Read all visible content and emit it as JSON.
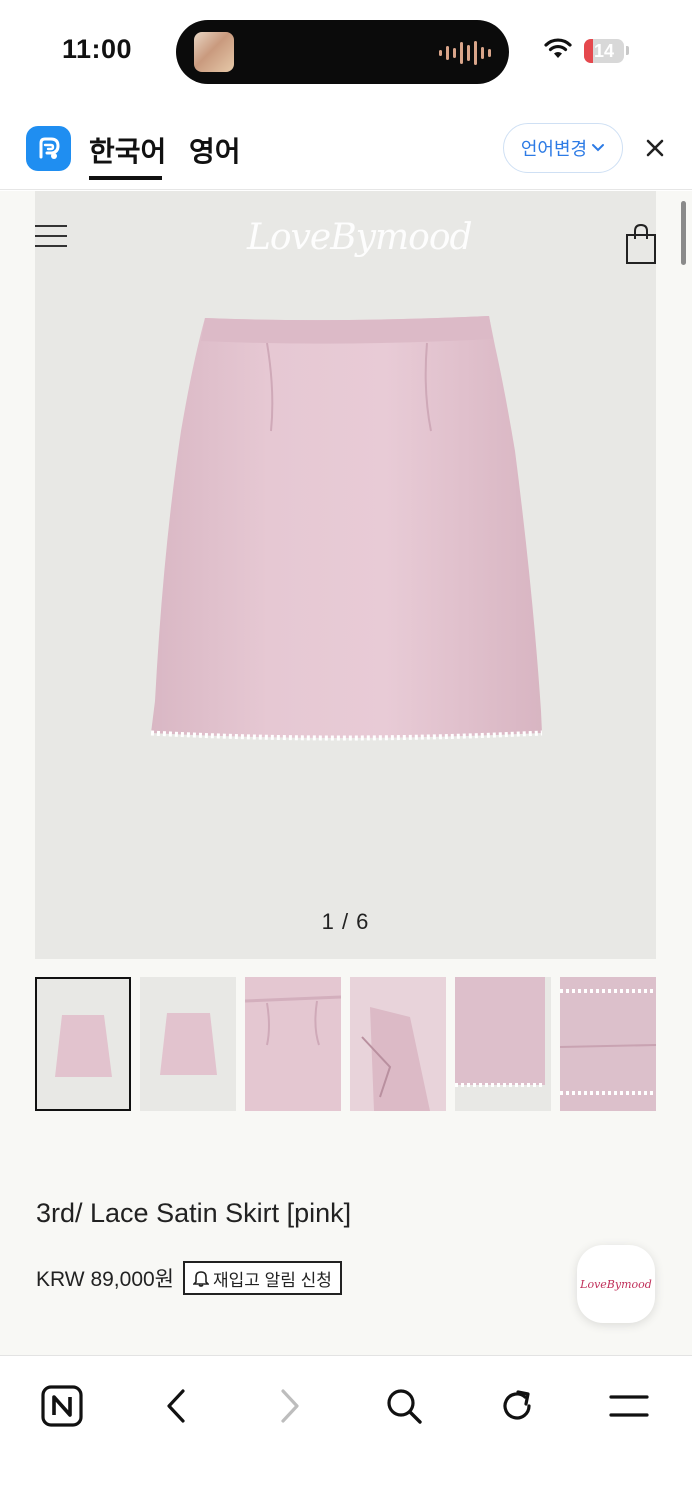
{
  "status_bar": {
    "time": "11:00",
    "battery_level": "14",
    "battery_fraction": 0.14
  },
  "translate_bar": {
    "tabs": [
      {
        "label": "한국어",
        "selected": true
      },
      {
        "label": "영어",
        "selected": false
      }
    ],
    "change_language_label": "언어변경",
    "icons": [
      "papago-icon",
      "chevron-down-icon",
      "close-icon"
    ]
  },
  "site": {
    "brand": "LoveBymood",
    "image_counter": "1 / 6",
    "thumbnail_count": 6,
    "product_name": "3rd/ Lace Satin Skirt [pink]",
    "price": "KRW 89,000원",
    "restock_label": "재입고 알림 신청",
    "floating_logo": "LoveBymood",
    "colors": {
      "background": "#f8f8f5",
      "image_bg": "#e8e8e5",
      "skirt_pink": "#e4c5d0",
      "link_blue": "#2d7be5",
      "papago_blue": "#1f8ef1"
    }
  },
  "toolbar": {
    "icons": [
      "naver-home-icon",
      "back-icon",
      "forward-icon",
      "search-icon",
      "refresh-icon",
      "menu-icon"
    ]
  }
}
